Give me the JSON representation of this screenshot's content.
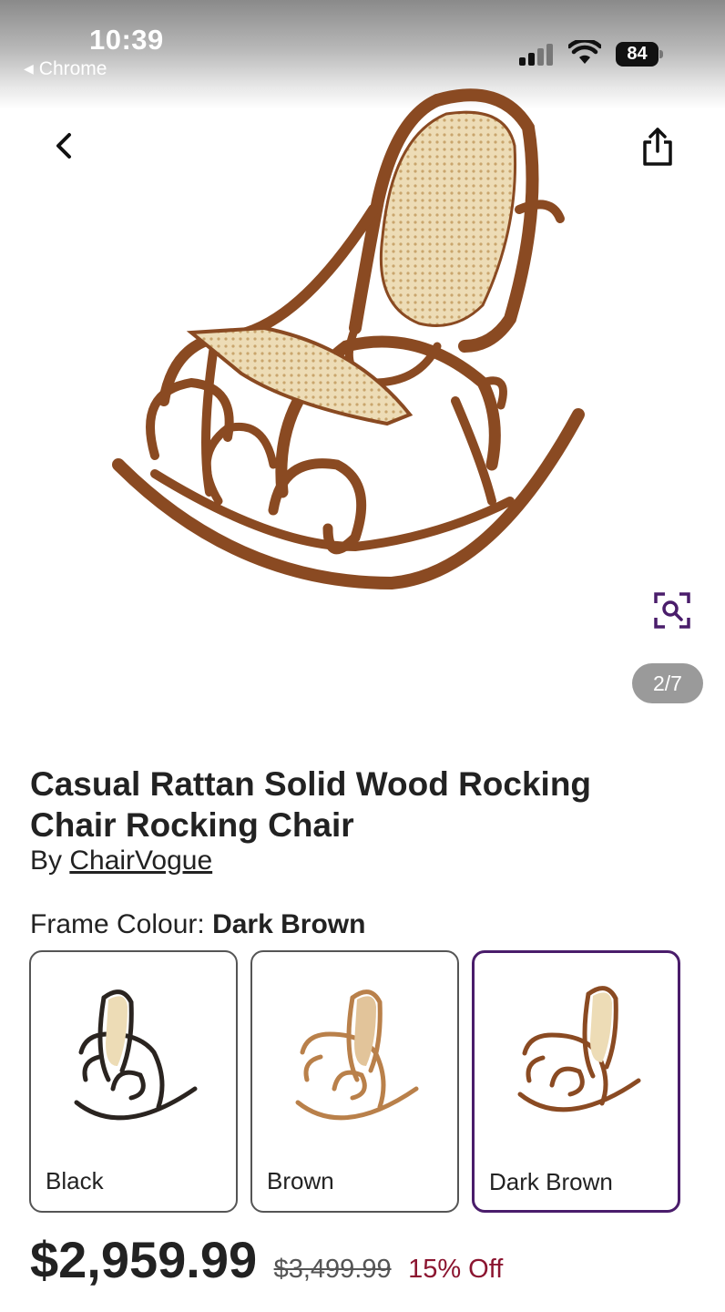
{
  "status_bar": {
    "time": "10:39",
    "back_app": "Chrome",
    "battery": "84"
  },
  "icons": {
    "back": "chevron-left-icon",
    "share": "share-icon",
    "zoom": "zoom-search-icon"
  },
  "gallery": {
    "counter": "2/7"
  },
  "product": {
    "title": "Casual Rattan Solid Wood Rocking Chair Rocking Chair",
    "by_prefix": "By",
    "brand": "ChairVogue",
    "option_label": "Frame Colour:",
    "selected_option": "Dark Brown",
    "options": [
      {
        "label": "Black",
        "color": "#2a2420"
      },
      {
        "label": "Brown",
        "color": "#b9804a"
      },
      {
        "label": "Dark Brown",
        "color": "#8a4a22"
      }
    ],
    "price": "$2,959.99",
    "was_price": "$3,499.99",
    "discount": "15% Off"
  },
  "colors": {
    "accent": "#4a1d6b",
    "discount": "#8b1530",
    "wood": "#8a4a22",
    "cane": "#e9d9b3"
  }
}
